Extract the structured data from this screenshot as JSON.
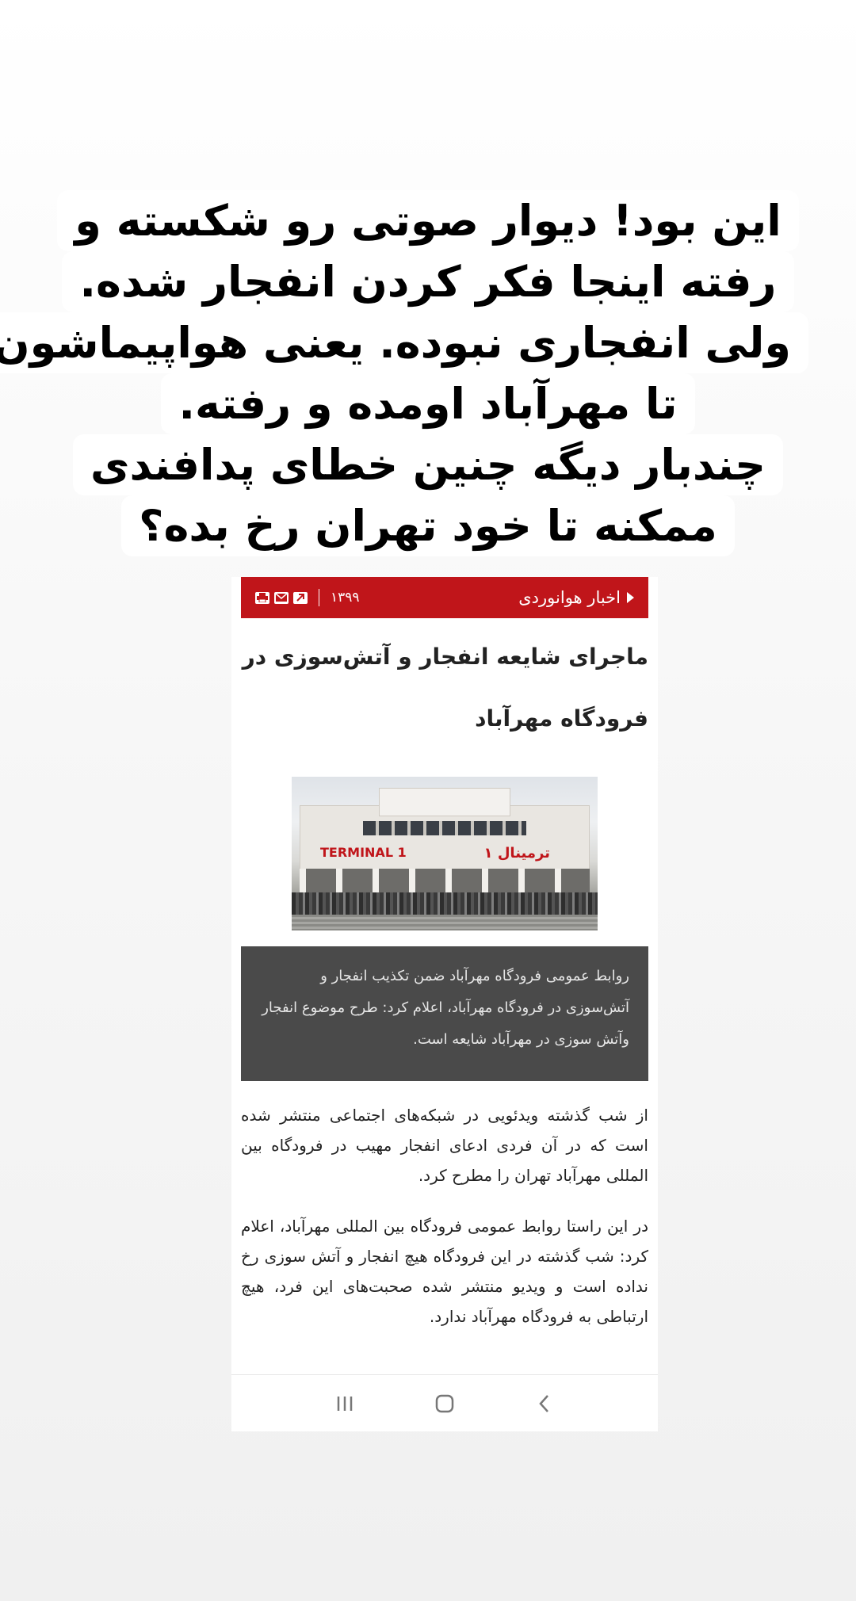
{
  "caption": {
    "lines": [
      "این بود! دیوار صوتی رو شکسته و",
      "رفته اینجا فکر کردن انفجار شده.",
      "ولی انفجاری نبوده. یعنی هواپیماشون",
      "تا مهرآباد اومده و رفته.",
      "چندبار دیگه چنین خطای پدافندی",
      "ممکنه تا خود تهران رخ بده؟"
    ]
  },
  "article": {
    "category": "اخبار هوانوردی",
    "year": "۱۳۹۹",
    "headline_line1": "ماجرای شایعه انفجار و آتش‌سوزی در",
    "headline_line2": "فرودگاه مهرآباد",
    "photo": {
      "sign_en": "TERMINAL 1",
      "sign_fa": "ترمینال ۱"
    },
    "summary": "روابط عمومی فرودگاه مهرآباد ضمن تکذیب انفجار و آتش‌سوزی در فرودگاه مهرآباد، اعلام کرد: طرح موضوع انفجار وآتش سوزی در مهرآباد شایعه است.",
    "paragraph1": "از شب گذشته ویدئویی در شبکه‌های اجتماعی منتشر شده است که در آن فردی ادعای انفجار مهیب در فرودگاه بین المللی مهرآباد تهران را مطرح کرد.",
    "paragraph2": "در این راستا روابط عمومی فرودگاه بین المللی مهرآباد، اعلام کرد: شب گذشته در این فرودگاه هیچ انفجار و آتش سوزی رخ نداده است و ویدیو منتشر شده صحبت‌های این فرد، هیچ ارتباطی به فرودگاه مهرآباد ندارد."
  },
  "toolbar_icons": [
    "print-icon",
    "mail-icon",
    "share-icon"
  ],
  "nav": {
    "icons": [
      "recents-icon",
      "home-icon",
      "back-icon"
    ]
  },
  "colors": {
    "news_bar": "#c0151a",
    "summary_box": "#4a4a4a"
  }
}
